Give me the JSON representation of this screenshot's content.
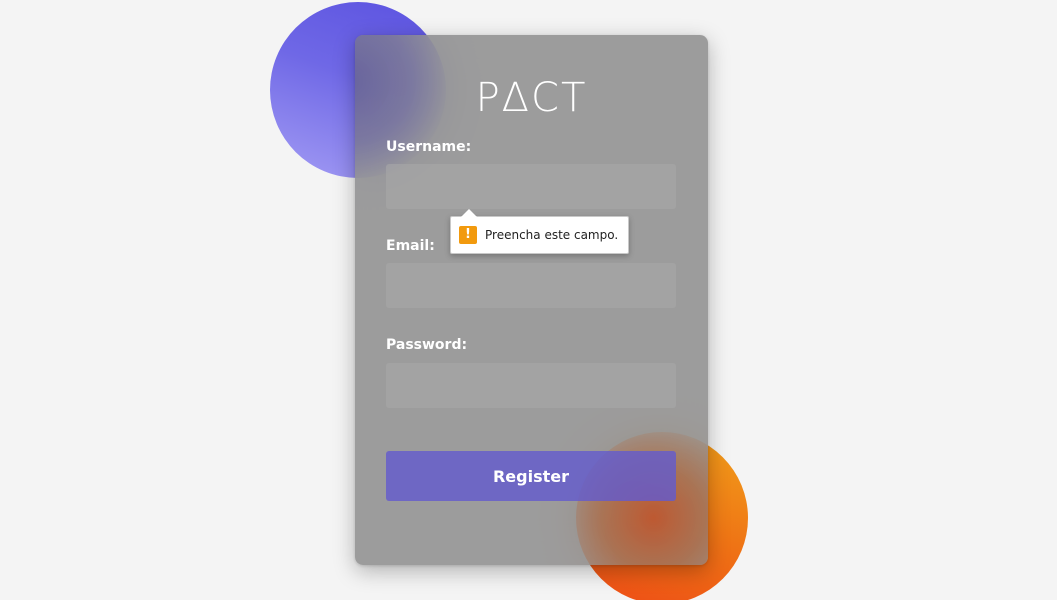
{
  "app": {
    "logo": "PΔCT"
  },
  "form": {
    "username": {
      "label": "Username:",
      "value": "",
      "placeholder": ""
    },
    "email": {
      "label": "Email:",
      "value": "",
      "placeholder": ""
    },
    "password": {
      "label": "Password:",
      "value": "",
      "placeholder": ""
    },
    "register_label": "Register"
  },
  "validation_tooltip": {
    "icon": "warning-icon",
    "icon_glyph": "!",
    "message": "Preencha este campo."
  },
  "colors": {
    "background": "#f4f4f4",
    "blob_blue": "#5b52e0",
    "blob_orange": "#ef7415",
    "button": "#645ccd",
    "warning": "#f29a0e"
  }
}
